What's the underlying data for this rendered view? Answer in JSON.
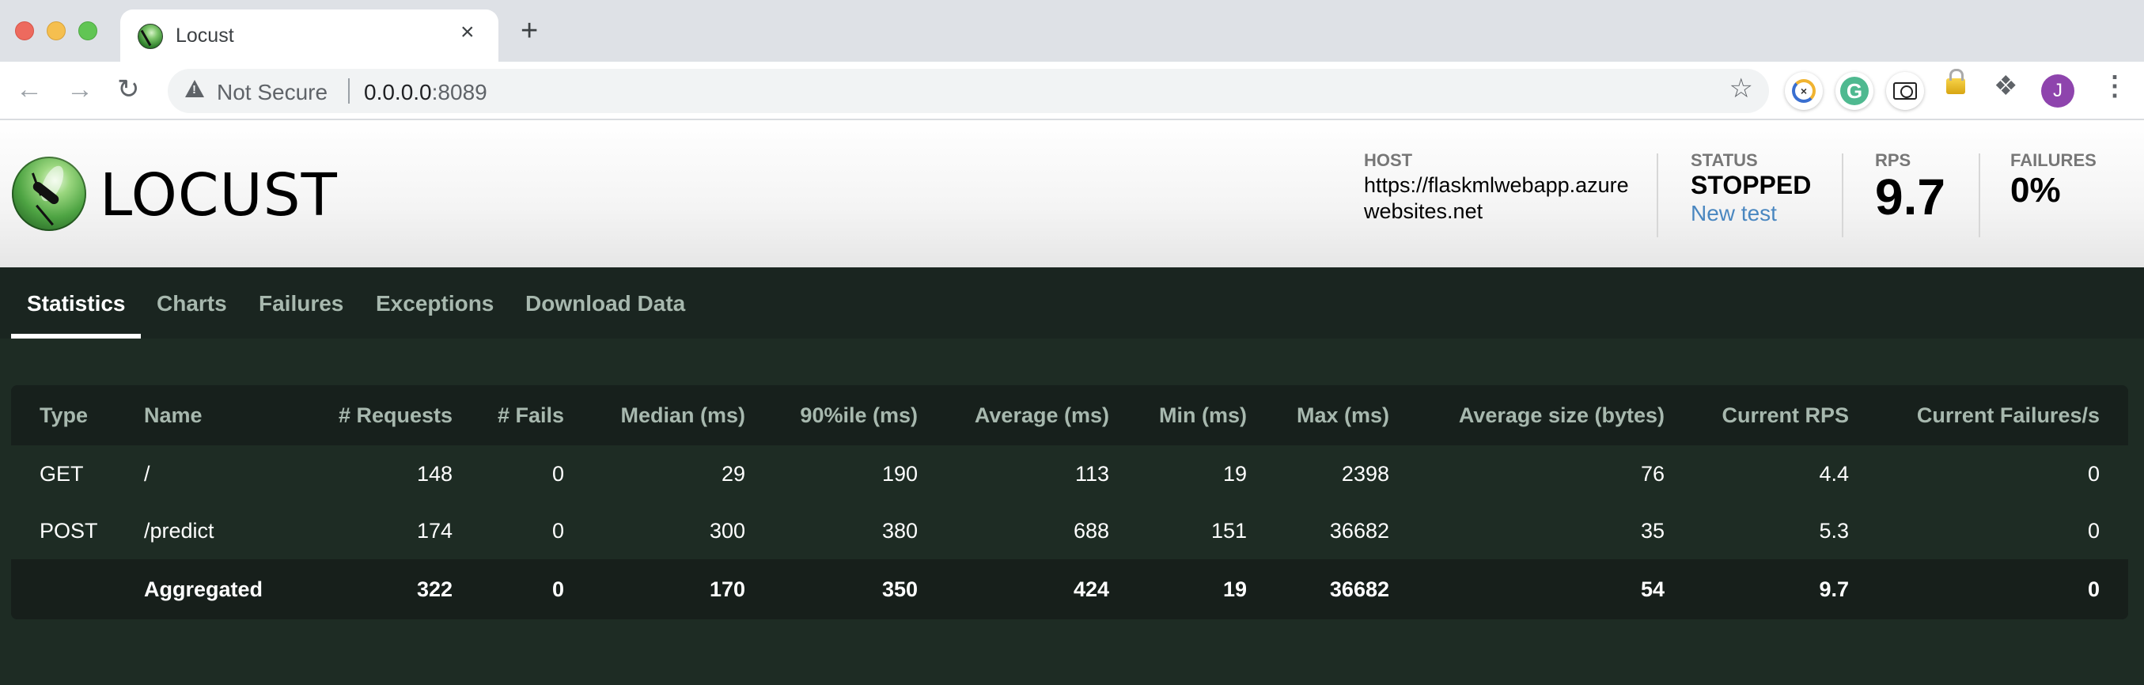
{
  "browser": {
    "tab_title": "Locust",
    "tab_close": "×",
    "new_tab": "+",
    "security_label": "Not Secure",
    "url_host": "0.0.0.0",
    "url_port": ":8089",
    "profile_initial": "J",
    "extension_icons": [
      "clockify-extension-icon",
      "grammarly-extension-icon",
      "screenshot-extension-icon",
      "lock-extension-icon",
      "extensions-puzzle-icon"
    ]
  },
  "header": {
    "logo_text": "LOCUST",
    "host_label": "HOST",
    "host_value": "https://flaskmlwebapp.azurewebsites.net",
    "status_label": "STATUS",
    "status_value": "STOPPED",
    "new_test_label": "New test",
    "rps_label": "RPS",
    "rps_value": "9.7",
    "failures_label": "FAILURES",
    "failures_value": "0%"
  },
  "tabs": [
    {
      "label": "Statistics",
      "active": true
    },
    {
      "label": "Charts",
      "active": false
    },
    {
      "label": "Failures",
      "active": false
    },
    {
      "label": "Exceptions",
      "active": false
    },
    {
      "label": "Download Data",
      "active": false
    }
  ],
  "table": {
    "columns": [
      "Type",
      "Name",
      "# Requests",
      "# Fails",
      "Median (ms)",
      "90%ile (ms)",
      "Average (ms)",
      "Min (ms)",
      "Max (ms)",
      "Average size (bytes)",
      "Current RPS",
      "Current Failures/s"
    ],
    "rows": [
      [
        "GET",
        "/",
        "148",
        "0",
        "29",
        "190",
        "113",
        "19",
        "2398",
        "76",
        "4.4",
        "0"
      ],
      [
        "POST",
        "/predict",
        "174",
        "0",
        "300",
        "380",
        "688",
        "151",
        "36682",
        "35",
        "5.3",
        "0"
      ]
    ],
    "aggregated": [
      "",
      "Aggregated",
      "322",
      "0",
      "170",
      "350",
      "424",
      "19",
      "36682",
      "54",
      "9.7",
      "0"
    ]
  },
  "colors": {
    "header_bg": "#ffffff",
    "tabs_bg": "#1a2520",
    "content_bg": "#1e2c24",
    "table_head_bg": "#17201c",
    "header_text": "#a7b8ae",
    "link": "#4a87c0"
  }
}
